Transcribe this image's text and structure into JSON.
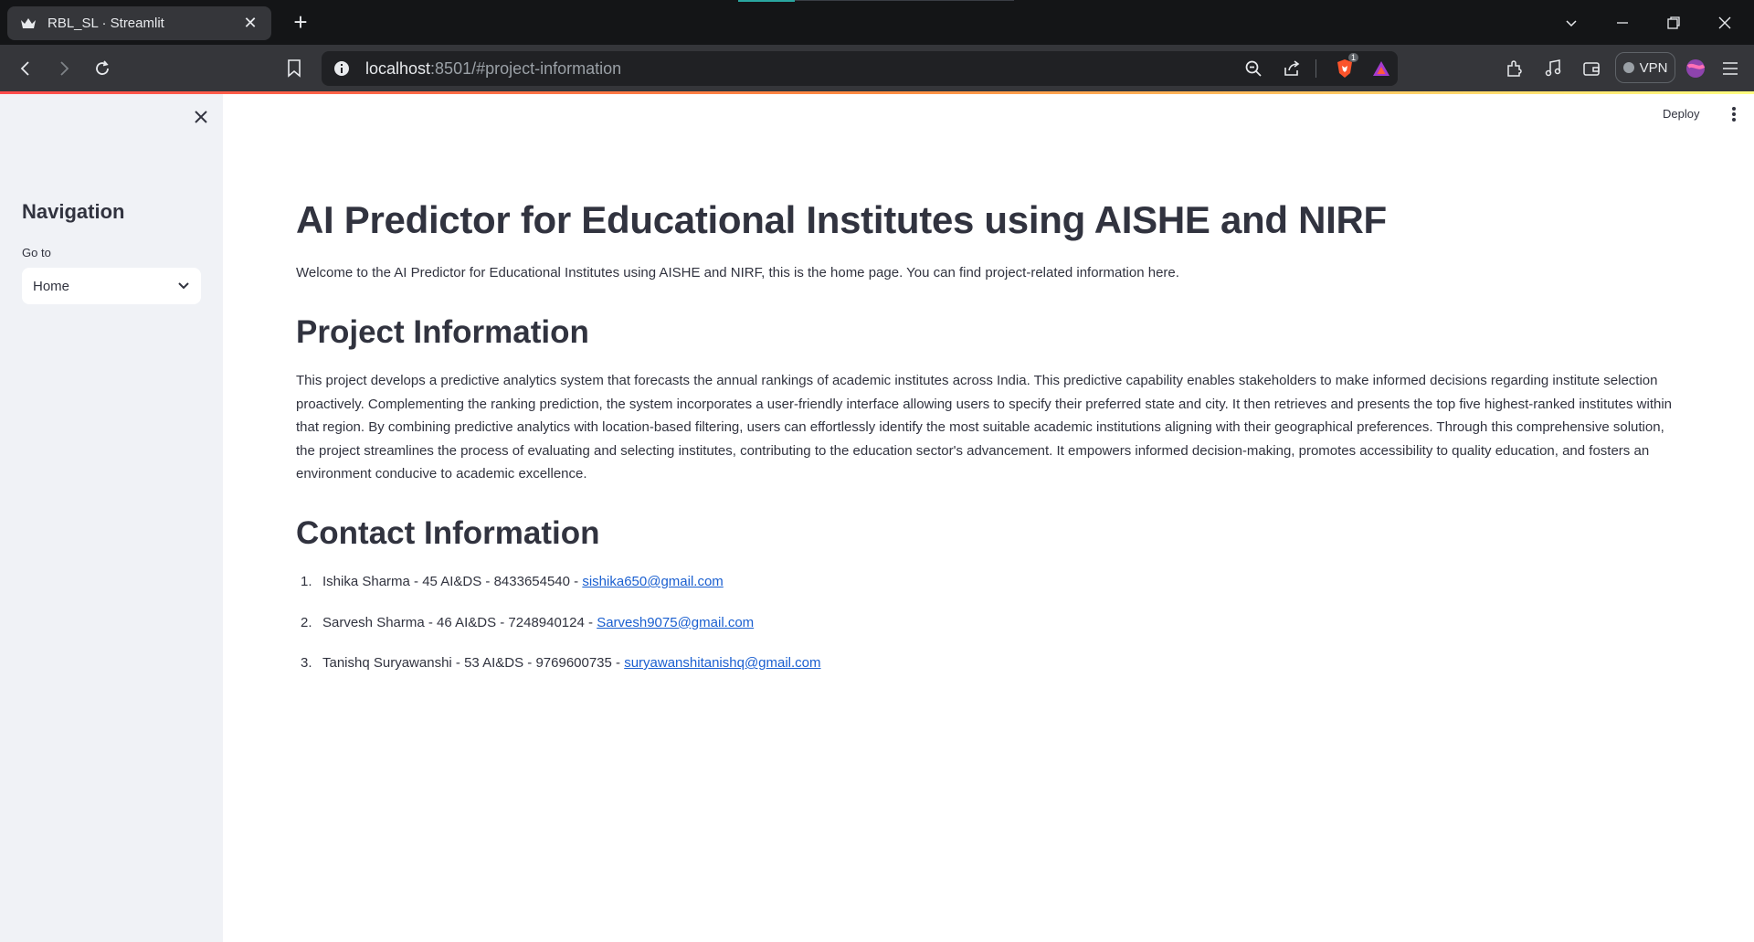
{
  "browser": {
    "tab": {
      "title": "RBL_SL · Streamlit"
    },
    "url": {
      "host": "localhost",
      "rest": ":8501/#project-information"
    },
    "vpn_label": "VPN",
    "shield_badge": "1",
    "icons": [
      "back-icon",
      "forward-icon",
      "reload-icon",
      "bookmark-icon",
      "site-info-icon",
      "zoom-icon",
      "share-icon",
      "brave-shields-icon",
      "brave-rewards-icon",
      "extensions-icon",
      "media-icon",
      "wallet-icon",
      "profile-icon",
      "menu-icon"
    ]
  },
  "sidebar": {
    "title": "Navigation",
    "select_label": "Go to",
    "select_value": "Home"
  },
  "header": {
    "deploy_label": "Deploy"
  },
  "main": {
    "title": "AI Predictor for Educational Institutes using AISHE and NIRF",
    "welcome": "Welcome to the AI Predictor for Educational Institutes using AISHE and NIRF, this is the home page. You can find project-related information here.",
    "project_heading": "Project Information",
    "project_text": "This project develops a predictive analytics system that forecasts the annual rankings of academic institutes across India. This predictive capability enables stakeholders to make informed decisions regarding institute selection proactively. Complementing the ranking prediction, the system incorporates a user-friendly interface allowing users to specify their preferred state and city. It then retrieves and presents the top five highest-ranked institutes within that region. By combining predictive analytics with location-based filtering, users can effortlessly identify the most suitable academic institutions aligning with their geographical preferences. Through this comprehensive solution, the project streamlines the process of evaluating and selecting institutes, contributing to the education sector's advancement. It empowers informed decision-making, promotes accessibility to quality education, and fosters an environment conducive to academic excellence.",
    "contact_heading": "Contact Information",
    "contacts": [
      {
        "num": "1.",
        "text": "Ishika Sharma - 45 AI&DS - 8433654540 - ",
        "email": "sishika650@gmail.com"
      },
      {
        "num": "2.",
        "text": "Sarvesh Sharma - 46 AI&DS - 7248940124 - ",
        "email": "Sarvesh9075@gmail.com"
      },
      {
        "num": "3.",
        "text": "Tanishq Suryawanshi - 53 AI&DS - 9769600735 - ",
        "email": "suryawanshitanishq@gmail.com"
      }
    ]
  },
  "colors": {
    "accent_gradient": [
      "#ff4b4b",
      "#ff8c42",
      "#fffd80"
    ],
    "text": "#31333f",
    "sidebar_bg": "#f0f2f6",
    "link": "#1a5fd0"
  }
}
